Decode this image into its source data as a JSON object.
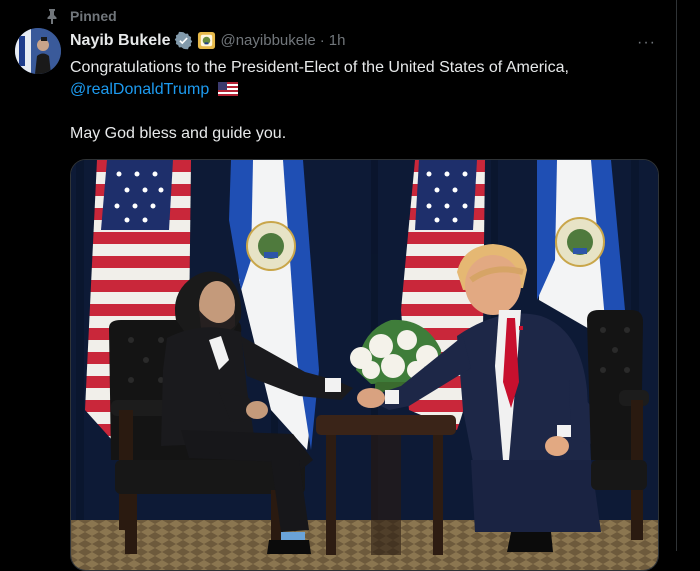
{
  "tweet": {
    "pinned_label": "Pinned",
    "author_name": "Nayib Bukele",
    "author_handle": "@nayibbukele",
    "separator": "·",
    "time": "1h",
    "text_line1": "Congratulations to the President-Elect of the United States of America,",
    "mention": "@realDonaldTrump",
    "text_line2": "May God bless and guide you.",
    "more_label": "···"
  },
  "icons": {
    "pin": "pin-icon",
    "verified": "verified-badge-icon",
    "affiliate": "government-affiliation-icon",
    "flag": "us-flag-emoji"
  },
  "colors": {
    "background": "#000000",
    "text": "#e7e9ea",
    "muted": "#71767b",
    "link": "#1d9bf0"
  }
}
